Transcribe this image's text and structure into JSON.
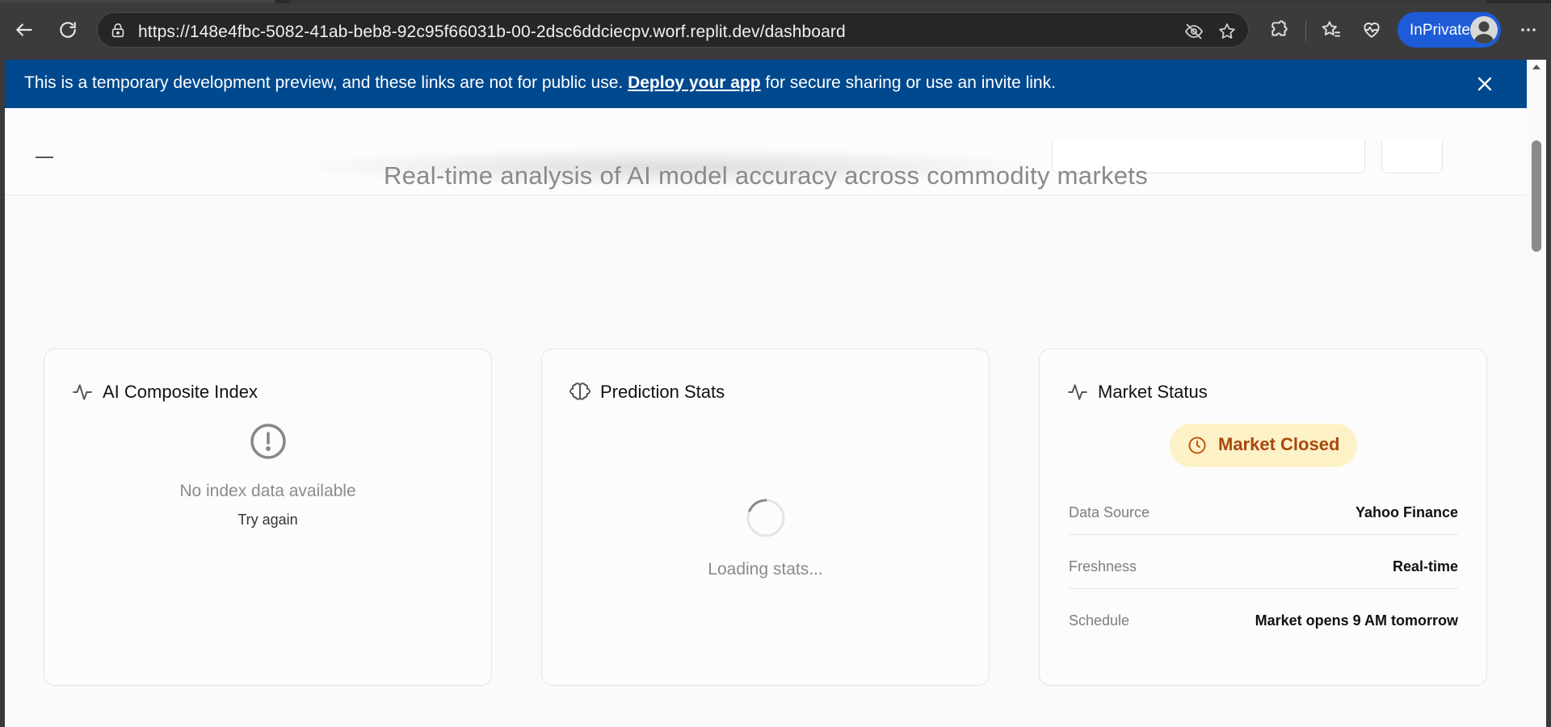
{
  "browser": {
    "url": "https://148e4fbc-5082-41ab-beb8-92c95f66031b-00-2dsc6ddciecpv.worf.replit.dev/dashboard",
    "inprivate_label": "InPrivate"
  },
  "banner": {
    "text_before": "This is a temporary development preview, and these links are not for public use. ",
    "link_text": "Deploy your app",
    "text_after": " for secure sharing or use an invite link."
  },
  "dashboard": {
    "subtitle": "Real-time analysis of AI model accuracy across commodity markets"
  },
  "cards": {
    "index": {
      "title": "AI Composite Index",
      "empty_text": "No index data available",
      "retry_label": "Try again"
    },
    "stats": {
      "title": "Prediction Stats",
      "loading_text": "Loading stats..."
    },
    "market": {
      "title": "Market Status",
      "badge": "Market Closed",
      "rows": [
        {
          "key": "Data Source",
          "value": "Yahoo Finance"
        },
        {
          "key": "Freshness",
          "value": "Real-time"
        },
        {
          "key": "Schedule",
          "value": "Market opens 9 AM tomorrow"
        }
      ]
    }
  },
  "colors": {
    "banner_bg": "#00498f",
    "badge_bg": "#fdf1c7",
    "badge_text": "#a9480e",
    "inprivate_bg": "#1e5bd6"
  }
}
